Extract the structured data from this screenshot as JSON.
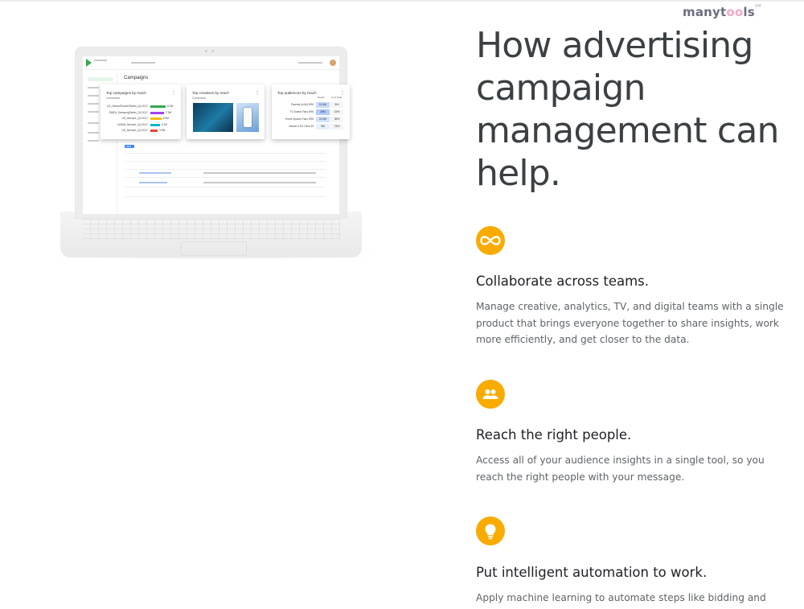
{
  "brand": {
    "name_a": "manyt",
    "name_b": "oo",
    "name_c": "ls",
    "tm": "SM"
  },
  "headline": "How advertising campaign management can help.",
  "features": [
    {
      "icon": "infinity-icon",
      "title": "Collaborate across teams.",
      "body": "Manage creative, analytics, TV, and digital teams with a single product that brings everyone together to share insights, work more efficiently, and get closer to the data."
    },
    {
      "icon": "people-icon",
      "title": "Reach the right people.",
      "body": "Access all of your audience insights in a single tool, so you reach the right people with your message."
    },
    {
      "icon": "lightbulb-icon",
      "title": "Put intelligent automation to work.",
      "body": "Apply machine learning to automate steps like bidding and"
    }
  ],
  "colors": {
    "accent": "#f9ab00",
    "text_dark": "#3c4043",
    "text_body": "#5f6368"
  },
  "laptop_screen": {
    "page_title": "Campaigns",
    "new_button": "NEW",
    "top_campaigns": {
      "title": "Top campaigns by reach",
      "subtitle": "Conversion",
      "rows": [
        {
          "label": "US_NexusPhoneDTablet_Q4 2017",
          "value": "8.3M",
          "fill": 0.95,
          "color": "#34a853"
        },
        {
          "label": "EMEA_SamsungTablet_Q4 2017",
          "value": "7.3M",
          "fill": 0.84,
          "color": "#a142f4"
        },
        {
          "label": "US_NexusX_Q4 2017",
          "value": "5.9M",
          "fill": 0.68,
          "color": "#fbbc04"
        },
        {
          "label": "LATAM_NexusX_Q4 2017",
          "value": "5.1M",
          "fill": 0.58,
          "color": "#12b5cb"
        },
        {
          "label": "US_NexusX_Q4 2017",
          "value": "3.9M",
          "fill": 0.45,
          "color": "#ea4335"
        }
      ]
    },
    "top_creatives": {
      "title": "Top creatives by reach",
      "subtitle": "Conversion"
    },
    "top_audiences": {
      "title": "Top audiences by reach",
      "head_reach": "Reach",
      "head_pct": "% of Total",
      "rows": [
        {
          "name": "Parents (in All) 9/95",
          "reach": "24.3M",
          "pct": "8%"
        },
        {
          "name": "TV Drama Fans 9/95",
          "reach": "28M",
          "pct": "15%"
        },
        {
          "name": "Home Spaces Fans 9/95",
          "reach": "24.3M",
          "pct": "35%"
        },
        {
          "name": "Marvel & DC Fans 33",
          "reach": "9M",
          "pct": "74%"
        }
      ]
    }
  }
}
